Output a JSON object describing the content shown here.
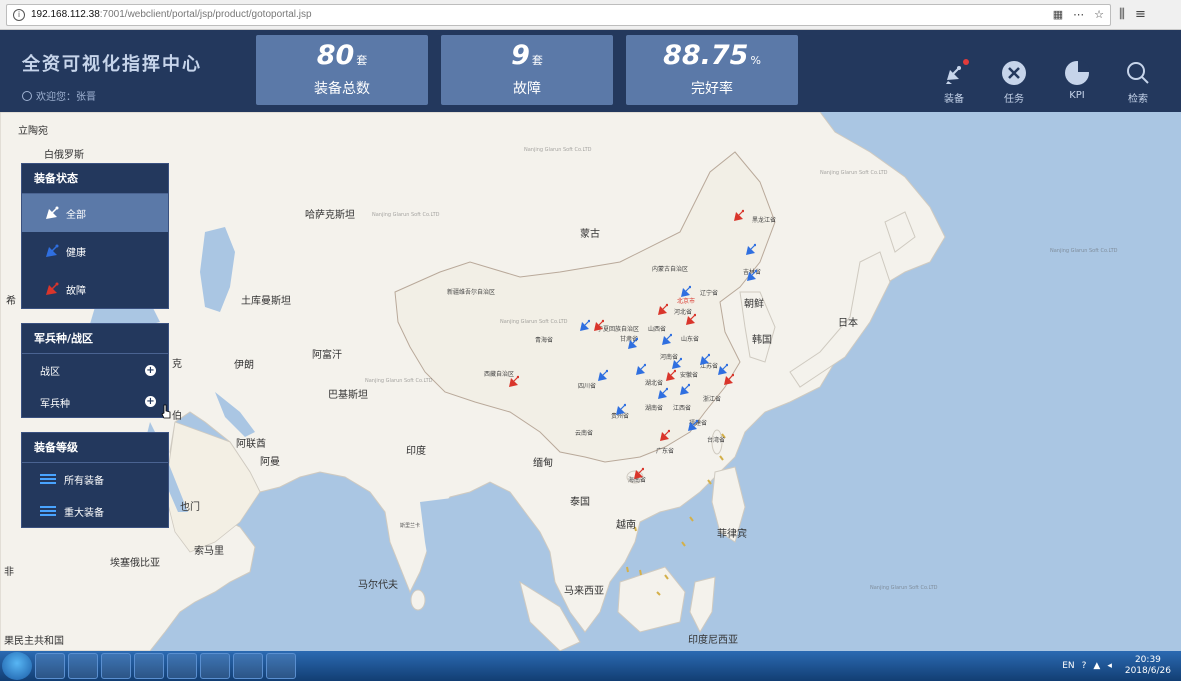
{
  "browser": {
    "info_glyph": "i",
    "url_host": "192.168.112.38",
    "url_path": ":7001/webclient/portal/jsp/product/gotoportal.jsp",
    "toolbar_glyphs": [
      "⋯",
      "☆"
    ]
  },
  "header": {
    "title": "全资可视化指挥中心",
    "welcome": "欢迎您：张晋",
    "stats": [
      {
        "value": "80",
        "unit": "套",
        "label": "装备总数"
      },
      {
        "value": "9",
        "unit": "套",
        "label": "故障"
      },
      {
        "value": "88.75",
        "unit": "%",
        "label": "完好率"
      }
    ],
    "nav": [
      {
        "label": "装备",
        "icon": "satellite-dish-icon"
      },
      {
        "label": "任务",
        "icon": "tools-icon"
      },
      {
        "label": "KPI",
        "icon": "pie-chart-icon"
      },
      {
        "label": "检索",
        "icon": "search-icon"
      }
    ]
  },
  "status_panel": {
    "title": "装备状态",
    "items": [
      {
        "label": "全部",
        "active": true,
        "color": "#ffffff"
      },
      {
        "label": "健康",
        "active": false,
        "color": "#2f6fe0"
      },
      {
        "label": "故障",
        "active": false,
        "color": "#d9352b"
      }
    ]
  },
  "branch_panel": {
    "title": "军兵种/战区",
    "items": [
      {
        "label": "战区",
        "expand": "+"
      },
      {
        "label": "军兵种",
        "expand": "+"
      }
    ]
  },
  "level_panel": {
    "title": "装备等级",
    "items": [
      {
        "label": "所有装备"
      },
      {
        "label": "重大装备"
      }
    ]
  },
  "map": {
    "watermark": "Nanjing Glarun Soft Co.LTD",
    "country_labels": [
      "立陶宛",
      "白俄罗斯",
      "哈萨克斯坦",
      "蒙古",
      "土库曼斯坦",
      "伊朗",
      "阿富汗",
      "巴基斯坦",
      "印度",
      "缅甸",
      "泰国",
      "越南",
      "菲律宾",
      "马来西亚",
      "印度尼西亚",
      "朝鲜",
      "韩国",
      "日本",
      "阿联酋",
      "阿曼",
      "也门",
      "索马里",
      "埃塞俄比亚",
      "马尔代夫",
      "斯里兰卡",
      "克",
      "伯",
      "希",
      "非",
      "果民主共和国",
      "新疆维吾尔自治区",
      "内蒙古自治区",
      "西藏自治区",
      "青海省",
      "四川省",
      "云南省",
      "贵州省",
      "湖南省",
      "江西省",
      "福建省",
      "台湾省",
      "广东省",
      "海南省",
      "湖北省",
      "安徽省",
      "浙江省",
      "江苏省",
      "山东省",
      "河南省",
      "河北省",
      "山西省",
      "宁夏回族自治区",
      "甘肃省",
      "辽宁省",
      "吉林省",
      "黑龙江省",
      "北京市"
    ],
    "marker_colors": {
      "healthy": "#2f6fe0",
      "fault": "#d9352b"
    }
  },
  "taskbar": {
    "lang": "EN",
    "time": "20:39",
    "date": "2018/6/26"
  }
}
